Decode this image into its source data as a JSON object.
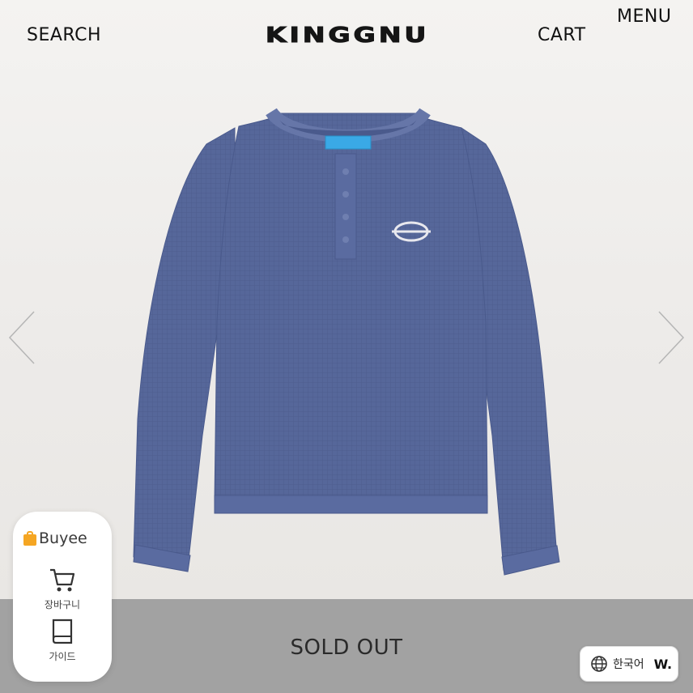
{
  "header": {
    "search_label": "SEARCH",
    "brand_logo": "KINGGNU",
    "cart_label": "CART",
    "menu_label": "MENU"
  },
  "carousel": {
    "prev_icon": "chevron-left-icon",
    "next_icon": "chevron-right-icon",
    "product_image": "blue-waffle-henley-long-sleeve-shirt"
  },
  "status": {
    "sold_out_label": "SOLD OUT"
  },
  "buyee_widget": {
    "brand_name": "Buyee",
    "cart_label": "장바구니",
    "guide_label": "가이드",
    "cart_icon": "shopping-cart-icon",
    "guide_icon": "book-icon"
  },
  "language_button": {
    "label": "한국어",
    "icon": "globe-icon",
    "brand_mark": "W."
  },
  "colors": {
    "background": "#efedeb",
    "sold_out_bar": "#a2a2a2",
    "shirt": "#56679a",
    "buyee_accent": "#f5a623"
  }
}
